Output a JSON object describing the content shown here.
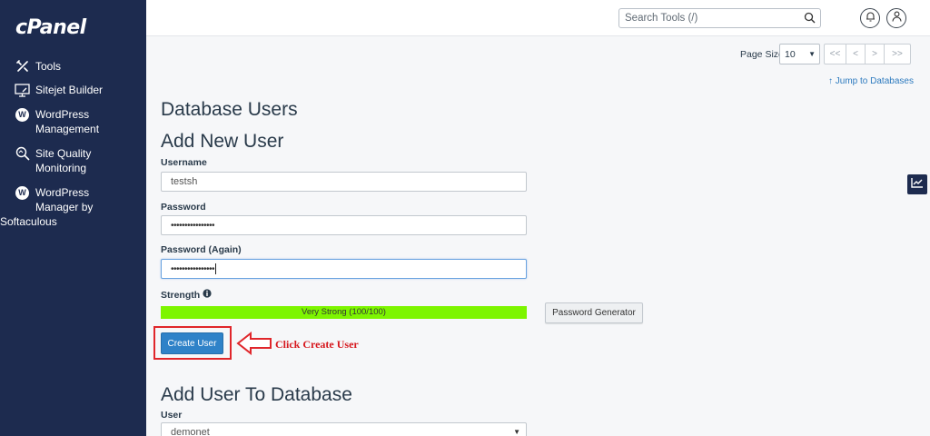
{
  "sidebar": {
    "logo": "cPanel",
    "items": [
      {
        "icon": "tools-icon",
        "lines": [
          "Tools"
        ]
      },
      {
        "icon": "sitejet-icon",
        "lines": [
          "Sitejet Builder"
        ]
      },
      {
        "icon": "wordpress-icon",
        "lines": [
          "WordPress",
          "Management"
        ]
      },
      {
        "icon": "site-quality-icon",
        "lines": [
          "Site Quality",
          "Monitoring"
        ]
      },
      {
        "icon": "wordpress-icon",
        "lines": [
          "WordPress",
          "Manager by",
          "Softaculous"
        ]
      }
    ]
  },
  "topbar": {
    "search_placeholder": "Search Tools (/)"
  },
  "pager": {
    "page_size_label": "Page Size",
    "page_size_value": "10",
    "buttons": [
      "<<",
      "<",
      ">",
      ">>"
    ]
  },
  "jump_link": "Jump to Databases",
  "section_title": "Database Users",
  "add_user": {
    "heading": "Add New User",
    "username_label": "Username",
    "username_value": "testsh",
    "password_label": "Password",
    "password_value": "••••••••••••••••",
    "password_again_label": "Password (Again)",
    "password_again_value": "••••••••••••••••",
    "strength_label": "Strength",
    "strength_text": "Very Strong (100/100)",
    "strength_value": 100,
    "password_generator_label": "Password Generator",
    "create_button_label": "Create User"
  },
  "annotation": {
    "text": "Click Create User",
    "color": "#d6171d"
  },
  "add_to_db": {
    "heading": "Add User To Database",
    "user_label": "User",
    "user_value": "demonet"
  },
  "colors": {
    "sidebar_bg": "#1d2b4f",
    "primary": "#2f82c8",
    "strength": "#7df500",
    "annotation_red": "#e0262b"
  }
}
